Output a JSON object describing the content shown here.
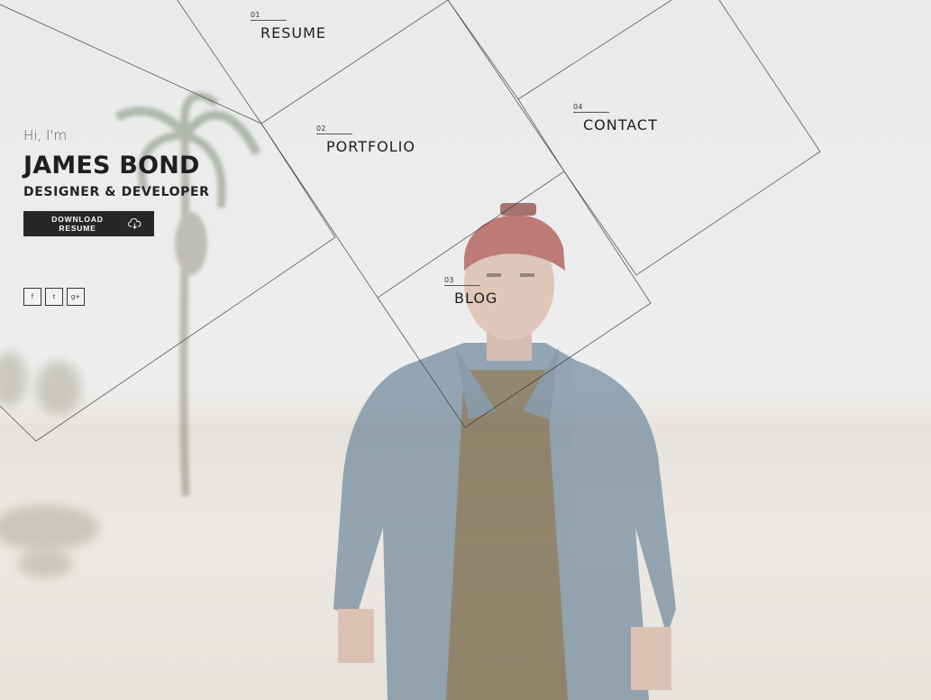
{
  "intro": {
    "greeting": "Hi, I'm",
    "name": "JAMES BOND",
    "role": "DESIGNER & DEVELOPER",
    "download_label": "DOWNLOAD RESUME"
  },
  "nav": [
    {
      "num": "01",
      "label": "RESUME"
    },
    {
      "num": "02",
      "label": "PORTFOLIO"
    },
    {
      "num": "03",
      "label": "BLOG"
    },
    {
      "num": "04",
      "label": "CONTACT"
    }
  ],
  "socials": [
    {
      "glyph": "f",
      "icon": "facebook-icon"
    },
    {
      "glyph": "t",
      "icon": "twitter-icon"
    },
    {
      "glyph": "g+",
      "icon": "google-plus-icon"
    }
  ],
  "colors": {
    "button_bg": "#272727",
    "text_dark": "#1f1f1f",
    "background": "#eaeaea"
  }
}
